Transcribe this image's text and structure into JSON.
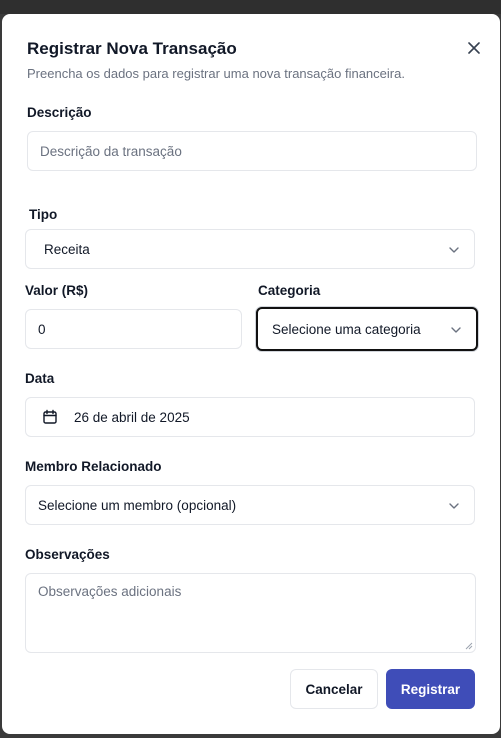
{
  "dialog": {
    "title": "Registrar Nova Transação",
    "subtitle": "Preencha os dados para registrar uma nova transação financeira."
  },
  "form": {
    "descricao": {
      "label": "Descrição",
      "placeholder": "Descrição da transação"
    },
    "tipo": {
      "label": "Tipo",
      "value": "Receita"
    },
    "valor": {
      "label": "Valor (R$)",
      "value": "0"
    },
    "categoria": {
      "label": "Categoria",
      "value": "Selecione uma categoria"
    },
    "data": {
      "label": "Data",
      "value": "26 de abril de 2025",
      "icon": "calendar-icon"
    },
    "membro": {
      "label": "Membro Relacionado",
      "value": "Selecione um membro (opcional)"
    },
    "observacoes": {
      "label": "Observações",
      "placeholder": "Observações adicionais"
    }
  },
  "actions": {
    "cancel_label": "Cancelar",
    "submit_label": "Registrar"
  },
  "colors": {
    "primary": "#3f4db8",
    "border": "#e5e7eb",
    "muted": "#6b7280"
  }
}
